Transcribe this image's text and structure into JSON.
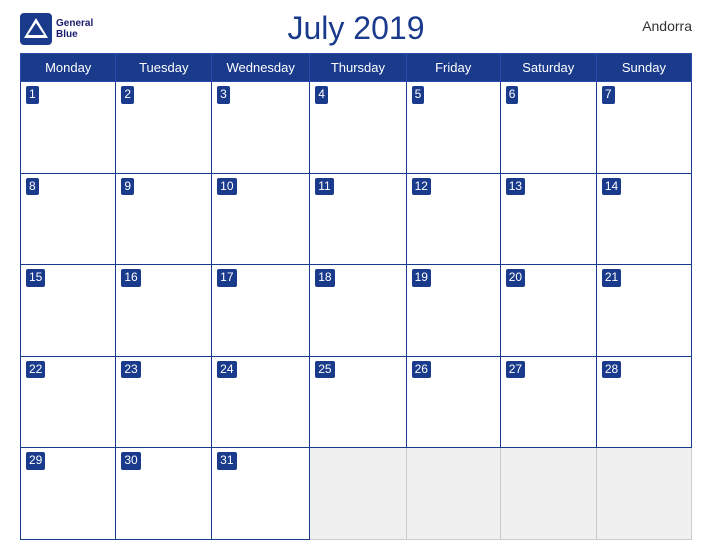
{
  "header": {
    "title": "July 2019",
    "country": "Andorra",
    "logo_line1": "General",
    "logo_line2": "Blue"
  },
  "days_of_week": [
    "Monday",
    "Tuesday",
    "Wednesday",
    "Thursday",
    "Friday",
    "Saturday",
    "Sunday"
  ],
  "weeks": [
    [
      1,
      2,
      3,
      4,
      5,
      6,
      7
    ],
    [
      8,
      9,
      10,
      11,
      12,
      13,
      14
    ],
    [
      15,
      16,
      17,
      18,
      19,
      20,
      21
    ],
    [
      22,
      23,
      24,
      25,
      26,
      27,
      28
    ],
    [
      29,
      30,
      31,
      null,
      null,
      null,
      null
    ]
  ]
}
